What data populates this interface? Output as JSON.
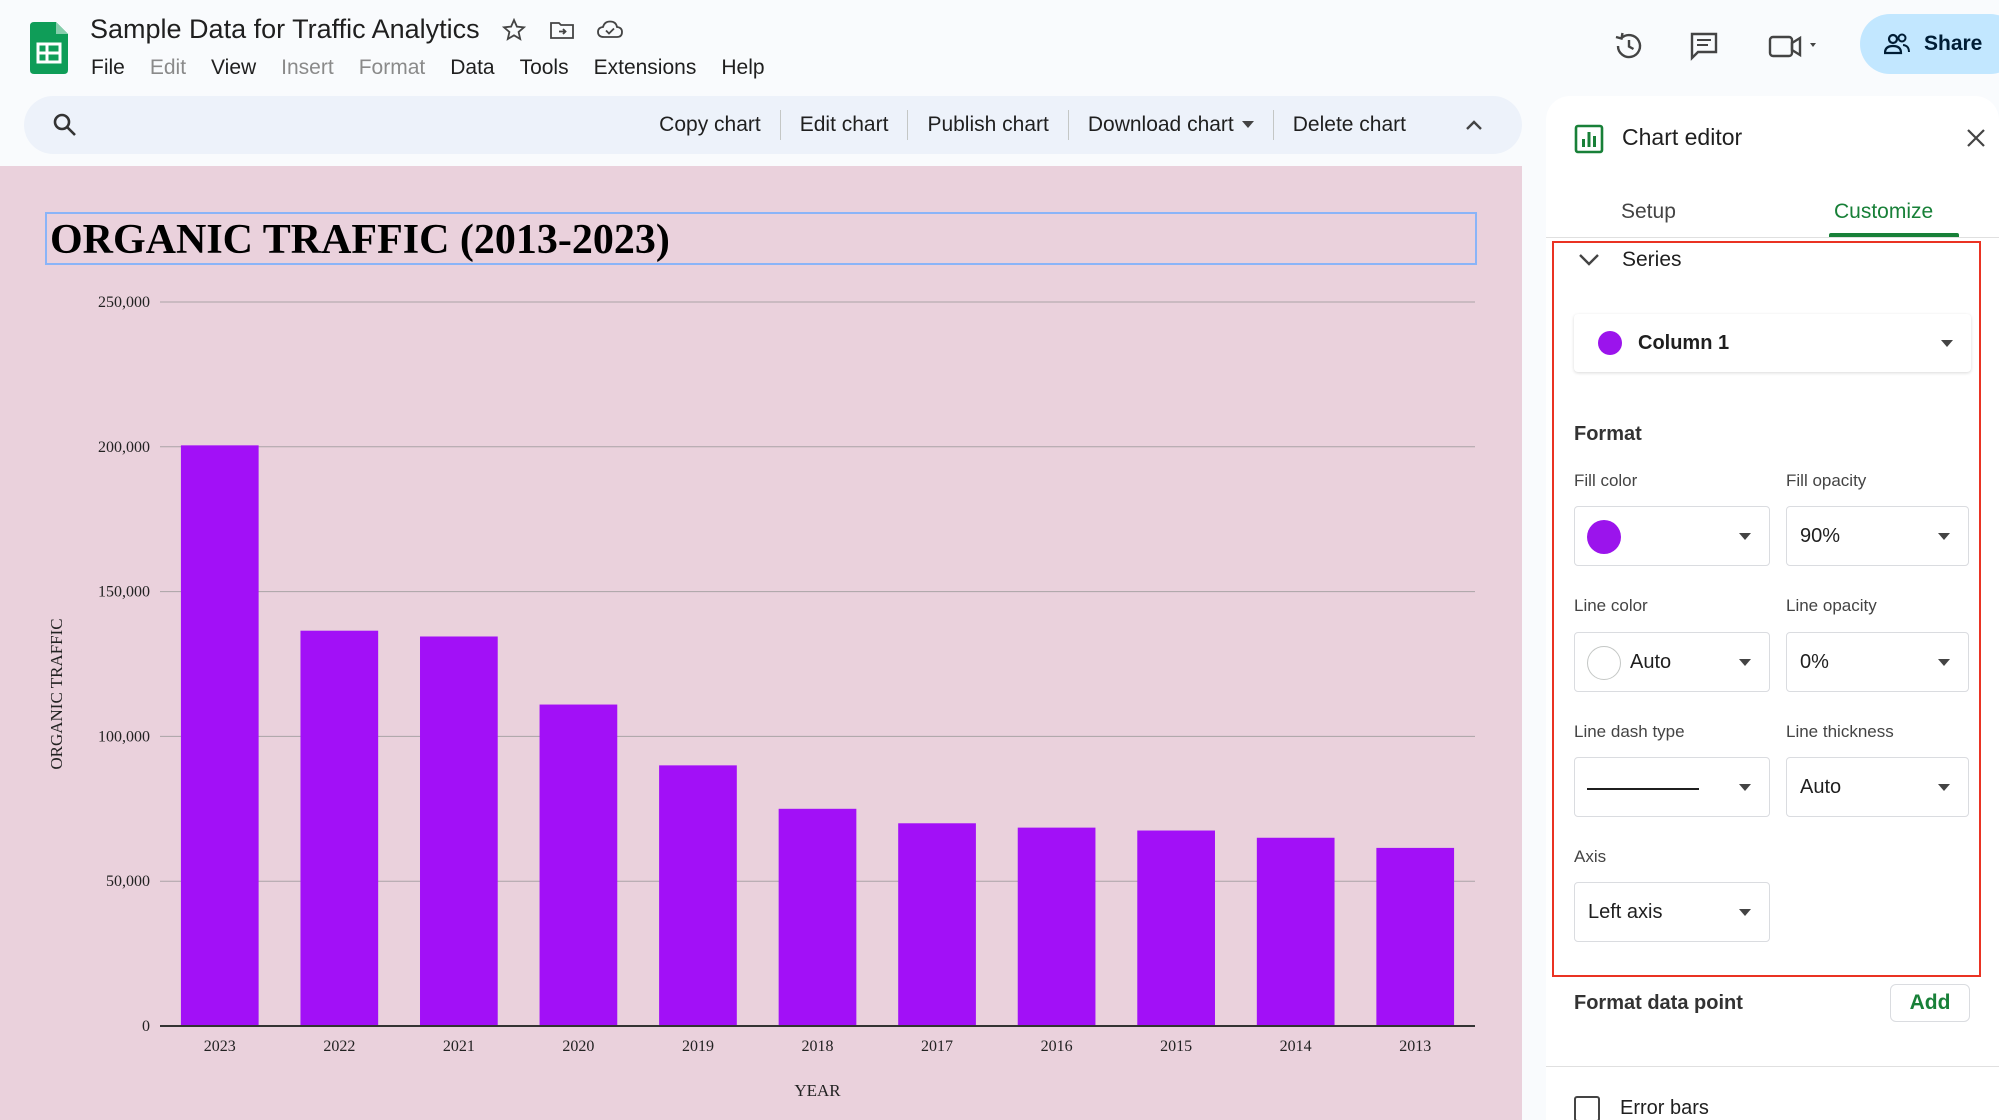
{
  "app": {
    "doc_title": "Sample Data for Traffic Analytics",
    "share_label": "Share",
    "menu": [
      "File",
      "Edit",
      "View",
      "Insert",
      "Format",
      "Data",
      "Tools",
      "Extensions",
      "Help"
    ],
    "menu_dimmed": [
      "Edit",
      "Insert",
      "Format"
    ],
    "icons": [
      "sheets-logo-icon",
      "star-icon",
      "move-folder-icon",
      "cloud-saved-icon",
      "version-history-icon",
      "comments-icon",
      "meet-video-icon",
      "share-people-icon"
    ]
  },
  "chart_toolbar": {
    "copy": "Copy chart",
    "edit": "Edit chart",
    "publish": "Publish chart",
    "download": "Download chart",
    "delete": "Delete chart"
  },
  "chart_data": {
    "type": "bar",
    "title": "ORGANIC TRAFFIC (2013-2023)",
    "xlabel": "YEAR",
    "ylabel": "ORGANIC TRAFFIC",
    "categories": [
      "2023",
      "2022",
      "2021",
      "2020",
      "2019",
      "2018",
      "2017",
      "2016",
      "2015",
      "2014",
      "2013"
    ],
    "values": [
      200500,
      136500,
      134500,
      111000,
      90000,
      75000,
      70000,
      68500,
      67500,
      65000,
      61500
    ],
    "yticks": [
      0,
      50000,
      100000,
      150000,
      200000,
      250000
    ],
    "ytick_labels": [
      "0",
      "50,000",
      "100,000",
      "150,000",
      "200,000",
      "250,000"
    ],
    "ylim": [
      0,
      250000
    ],
    "grid": true,
    "bar_color": "#a210f7",
    "background": "#ead1dc"
  },
  "editor": {
    "title": "Chart editor",
    "tabs": {
      "setup": "Setup",
      "customize": "Customize"
    },
    "section": "Series",
    "series_select": "Column 1",
    "series_color": "#9b14ec",
    "format_heading": "Format",
    "fill_color_label": "Fill color",
    "fill_color": "#9b14ec",
    "fill_opacity_label": "Fill opacity",
    "fill_opacity": "90%",
    "line_color_label": "Line color",
    "line_color": "Auto",
    "line_opacity_label": "Line opacity",
    "line_opacity": "0%",
    "line_dash_label": "Line dash type",
    "line_thickness_label": "Line thickness",
    "line_thickness": "Auto",
    "axis_label": "Axis",
    "axis": "Left axis",
    "format_data_point": "Format data point",
    "add": "Add",
    "error_bars": "Error bars"
  }
}
